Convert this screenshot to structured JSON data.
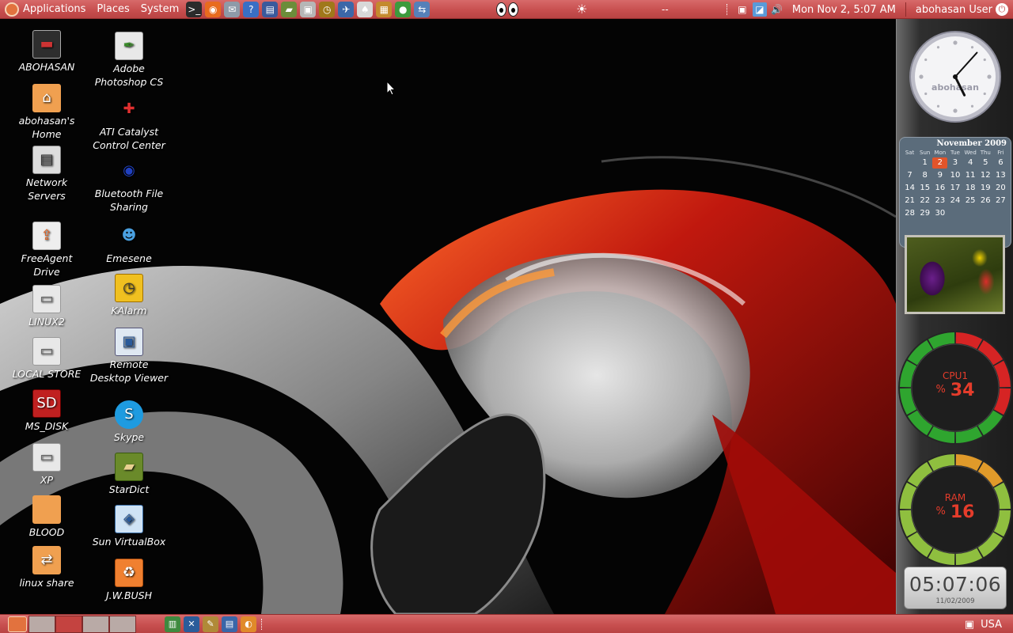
{
  "top_panel": {
    "menus": [
      "Applications",
      "Places",
      "System"
    ],
    "launchers": [
      {
        "icon": "terminal-icon",
        "glyph": ">_",
        "color": "#2b2b2b"
      },
      {
        "icon": "firefox-icon",
        "glyph": "◉",
        "color": "#e86b1e"
      },
      {
        "icon": "mail-icon",
        "glyph": "✉",
        "color": "#8e9aa8"
      },
      {
        "icon": "help-icon",
        "glyph": "?",
        "color": "#3a6fc4"
      },
      {
        "icon": "save-icon",
        "glyph": "▤",
        "color": "#3a5a9c"
      },
      {
        "icon": "stardict-icon",
        "glyph": "▰",
        "color": "#6c8d3a"
      },
      {
        "icon": "screenshot-icon",
        "glyph": "▣",
        "color": "#b6b6b6"
      },
      {
        "icon": "clock-app-icon",
        "glyph": "◷",
        "color": "#a0781a"
      },
      {
        "icon": "thunderbird-icon",
        "glyph": "✈",
        "color": "#3c67a8"
      },
      {
        "icon": "solitaire-icon",
        "glyph": "♠",
        "color": "#d8d8d8"
      },
      {
        "icon": "bulletin-icon",
        "glyph": "▦",
        "color": "#c48a2e"
      },
      {
        "icon": "green-ball-icon",
        "glyph": "●",
        "color": "#3d9a3d"
      },
      {
        "icon": "remote-icon",
        "glyph": "⇆",
        "color": "#5680b8"
      }
    ],
    "eyes_icon": "xeyes-icon",
    "sun_icon": "brightness-icon",
    "dashes": "--",
    "clock_text": "Mon Nov  2,  5:07 AM",
    "user_text": "abohasan User"
  },
  "desktop_icons": [
    {
      "label": "ABOHASAN",
      "icon": "computer-icon"
    },
    {
      "label": "abohasan's Home",
      "icon": "home-folder-icon"
    },
    {
      "label": "Network Servers",
      "icon": "network-servers-icon"
    },
    {
      "label": "FreeAgent Drive",
      "icon": "usb-drive-icon"
    },
    {
      "label": "LINUX2",
      "icon": "drive-icon"
    },
    {
      "label": "LOCAL STORE",
      "icon": "drive-icon"
    },
    {
      "label": "MS_DISK",
      "icon": "sd-card-icon"
    },
    {
      "label": "XP",
      "icon": "drive-icon"
    },
    {
      "label": "BLOOD",
      "icon": "folder-icon"
    },
    {
      "label": "linux share",
      "icon": "shared-folder-icon"
    },
    {
      "label": "Adobe Photoshop CS",
      "icon": "photoshop-icon"
    },
    {
      "label": "ATI Catalyst Control Center",
      "icon": "ati-icon"
    },
    {
      "label": "Bluetooth File Sharing",
      "icon": "bluetooth-icon"
    },
    {
      "label": "Emesene",
      "icon": "emesene-icon"
    },
    {
      "label": "KAlarm",
      "icon": "alarm-clock-icon"
    },
    {
      "label": "Remote Desktop Viewer",
      "icon": "remote-desktop-icon"
    },
    {
      "label": "Skype",
      "icon": "skype-icon"
    },
    {
      "label": "StarDict",
      "icon": "dictionary-icon"
    },
    {
      "label": "Sun VirtualBox",
      "icon": "virtualbox-icon"
    },
    {
      "label": "J.W.BUSH",
      "icon": "trash-icon"
    }
  ],
  "clock_gadget": {
    "brand": "abohasan",
    "hour": 5,
    "minute": 7
  },
  "calendar": {
    "title": "November 2009",
    "day_names": [
      "Sat",
      "Sun",
      "Mon",
      "Tue",
      "Wed",
      "Thu",
      "Fri"
    ],
    "leading_blanks": 1,
    "days": [
      "1",
      "2",
      "3",
      "4",
      "5",
      "6",
      "7",
      "8",
      "9",
      "10",
      "11",
      "12",
      "13",
      "14",
      "15",
      "16",
      "17",
      "18",
      "19",
      "20",
      "21",
      "22",
      "23",
      "24",
      "25",
      "26",
      "27",
      "28",
      "29",
      "30"
    ],
    "today": "2"
  },
  "cpu_gauge": {
    "label": "CPU1",
    "unit": "%",
    "value": "34",
    "fraction": 0.34
  },
  "ram_gauge": {
    "label": "RAM",
    "unit": "%",
    "value": "16",
    "fraction": 0.16
  },
  "digital_clock": {
    "time": "05:07:06",
    "date": "11/02/2009"
  },
  "bottom_panel": {
    "workspaces": 4,
    "active_workspace": 2,
    "launchers": [
      {
        "icon": "system-monitor-icon",
        "glyph": "▥",
        "color": "#3f8a3f"
      },
      {
        "icon": "tools-icon",
        "glyph": "✕",
        "color": "#2a5c9a"
      },
      {
        "icon": "settings-tools-icon",
        "glyph": "✎",
        "color": "#b08a38"
      },
      {
        "icon": "window-list-icon",
        "glyph": "▤",
        "color": "#3a66a8"
      },
      {
        "icon": "ubuntu-one-icon",
        "glyph": "◐",
        "color": "#e08a2a"
      }
    ],
    "keyboard_layout": "USA"
  },
  "colors": {
    "panel": "#c84f4f",
    "gauge_green": "#2fa52f",
    "gauge_red": "#d62424",
    "gauge_lime": "#8fbf3f",
    "gauge_orange": "#e09a2a",
    "accent_text": "#e43c2b"
  }
}
